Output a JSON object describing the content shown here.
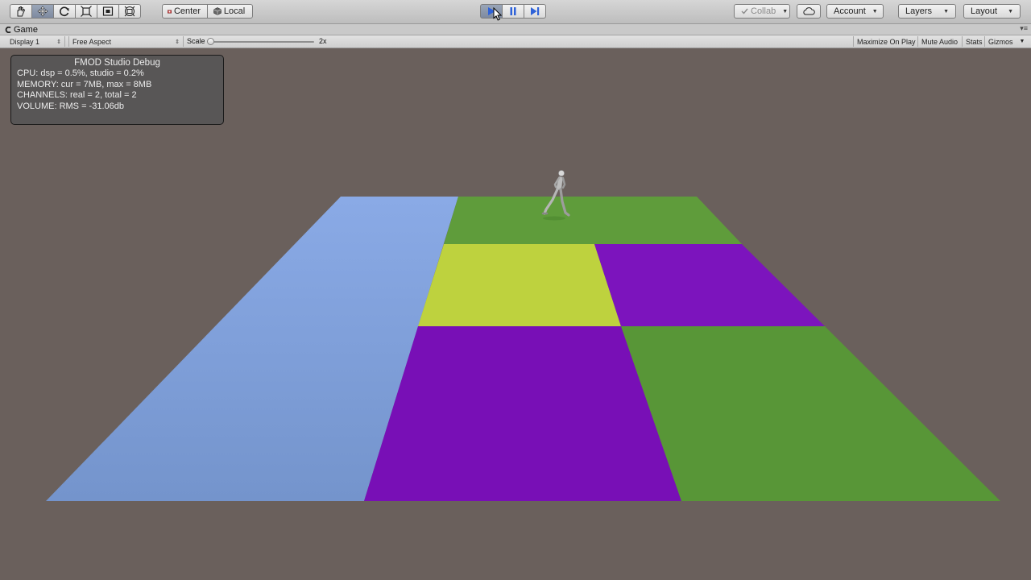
{
  "toolbar": {
    "tools": [
      {
        "name": "hand-tool",
        "icon": "hand-icon"
      },
      {
        "name": "move-tool",
        "icon": "move-icon"
      },
      {
        "name": "rotate-tool",
        "icon": "rotate-icon"
      },
      {
        "name": "scale-tool",
        "icon": "scale-icon"
      },
      {
        "name": "rect-tool",
        "icon": "rect-icon"
      },
      {
        "name": "transform-tool",
        "icon": "transform-icon"
      }
    ],
    "pivot_mode": "Center",
    "pivot_rotation": "Local",
    "play_state": "playing",
    "collab_label": "Collab",
    "account_label": "Account",
    "layers_label": "Layers",
    "layout_label": "Layout"
  },
  "game_tab": {
    "title": "Game",
    "display": "Display 1",
    "aspect": "Free Aspect",
    "scale_label": "Scale",
    "scale_value": "2x",
    "toggles": [
      "Maximize On Play",
      "Mute Audio",
      "Stats",
      "Gizmos"
    ]
  },
  "fmod_debug": {
    "title": "FMOD Studio Debug",
    "cpu": "CPU: dsp = 0.5%, studio = 0.2%",
    "memory": "MEMORY: cur = 7MB, max = 8MB",
    "channels": "CHANNELS: real = 2, total = 2",
    "volume": "VOLUME: RMS = -31.06db"
  },
  "scene": {
    "background": "#6a605c",
    "tile_colors": {
      "blue": "#7d9bd8",
      "green": "#5a9a3a",
      "yellow": "#bdd23c",
      "purple": "#7a12b8"
    }
  }
}
